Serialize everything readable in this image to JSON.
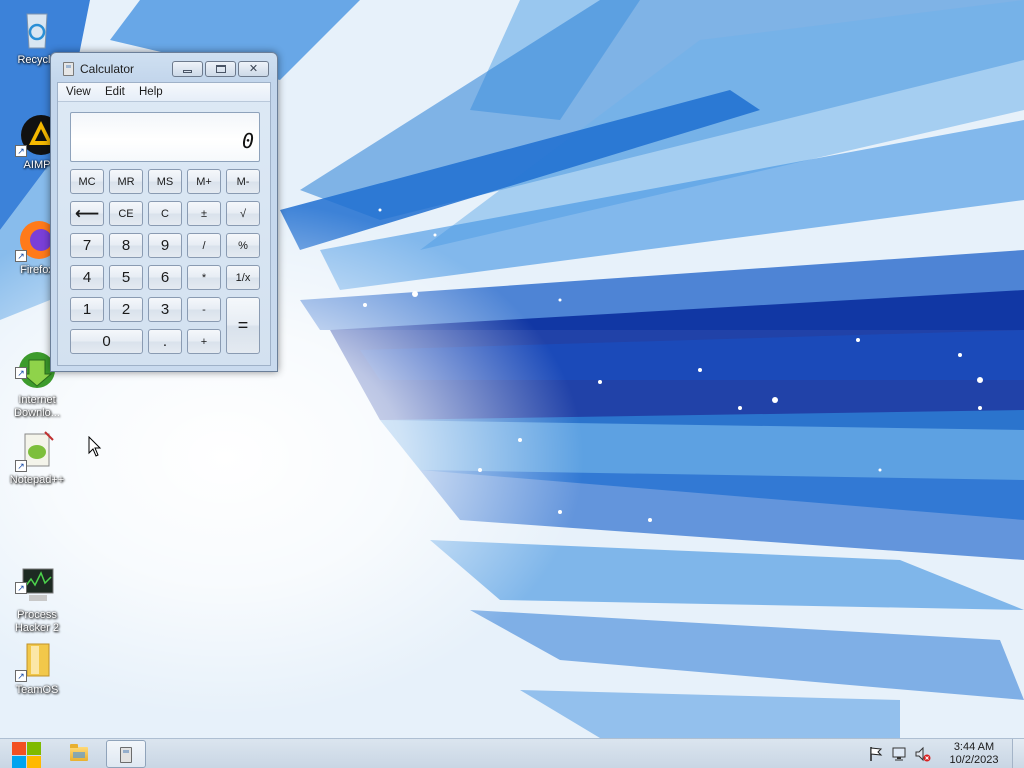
{
  "desktop": {
    "icons": [
      {
        "label": "Recycle",
        "icon": "recycle-bin-icon"
      },
      {
        "label": "AIMP",
        "icon": "aimp-icon"
      },
      {
        "label": "Firefox",
        "icon": "firefox-icon"
      },
      {
        "label": "Internet\nDownlo...",
        "icon": "internet-download-manager-icon"
      },
      {
        "label": "Notepad++",
        "icon": "notepad-plus-plus-icon"
      },
      {
        "label": "Process\nHacker 2",
        "icon": "process-hacker-icon"
      },
      {
        "label": "TeamOS",
        "icon": "folder-icon"
      }
    ]
  },
  "calculator": {
    "title": "Calculator",
    "menu": {
      "view": "View",
      "edit": "Edit",
      "help": "Help"
    },
    "display": "0",
    "keys": {
      "mc": "MC",
      "mr": "MR",
      "ms": "MS",
      "mplus": "M+",
      "mminus": "M-",
      "backspace": "⟵",
      "ce": "CE",
      "c": "C",
      "plusminus": "±",
      "sqrt": "√",
      "seven": "7",
      "eight": "8",
      "nine": "9",
      "divide": "/",
      "percent": "%",
      "four": "4",
      "five": "5",
      "six": "6",
      "multiply": "*",
      "reciprocal": "1/x",
      "one": "1",
      "two": "2",
      "three": "3",
      "minus": "-",
      "equals": "=",
      "zero": "0",
      "decimal": ".",
      "plus": "+"
    }
  },
  "taskbar": {
    "clock_time": "3:44 AM",
    "clock_date": "10/2/2023",
    "colors": {
      "accent": "#1e73d8"
    }
  }
}
